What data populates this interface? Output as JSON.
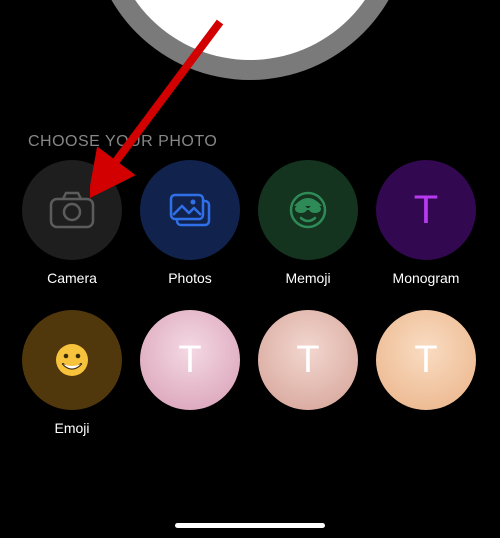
{
  "sectionTitle": "CHOOSE YOUR PHOTO",
  "options": {
    "camera": {
      "label": "Camera",
      "bg": "#1e1e1e"
    },
    "photos": {
      "label": "Photos",
      "bg": "#11234d"
    },
    "memoji": {
      "label": "Memoji",
      "bg": "#14341f"
    },
    "monogram": {
      "label": "Monogram",
      "bg": "#320851",
      "letter": "T"
    },
    "emoji": {
      "label": "Emoji",
      "bg": "#51370c"
    }
  },
  "samples": [
    {
      "bg": "#e0b0c5",
      "letter": "T"
    },
    {
      "bg": "#dfb4a9",
      "letter": "T"
    },
    {
      "bg": "#f0c09c",
      "letter": "T"
    }
  ],
  "colors": {
    "photosIcon": "#2f6fe8",
    "cameraIcon": "#5c5c5c",
    "monogramLetter": "#b83af0",
    "memojiIcon": "#2e8b57"
  }
}
